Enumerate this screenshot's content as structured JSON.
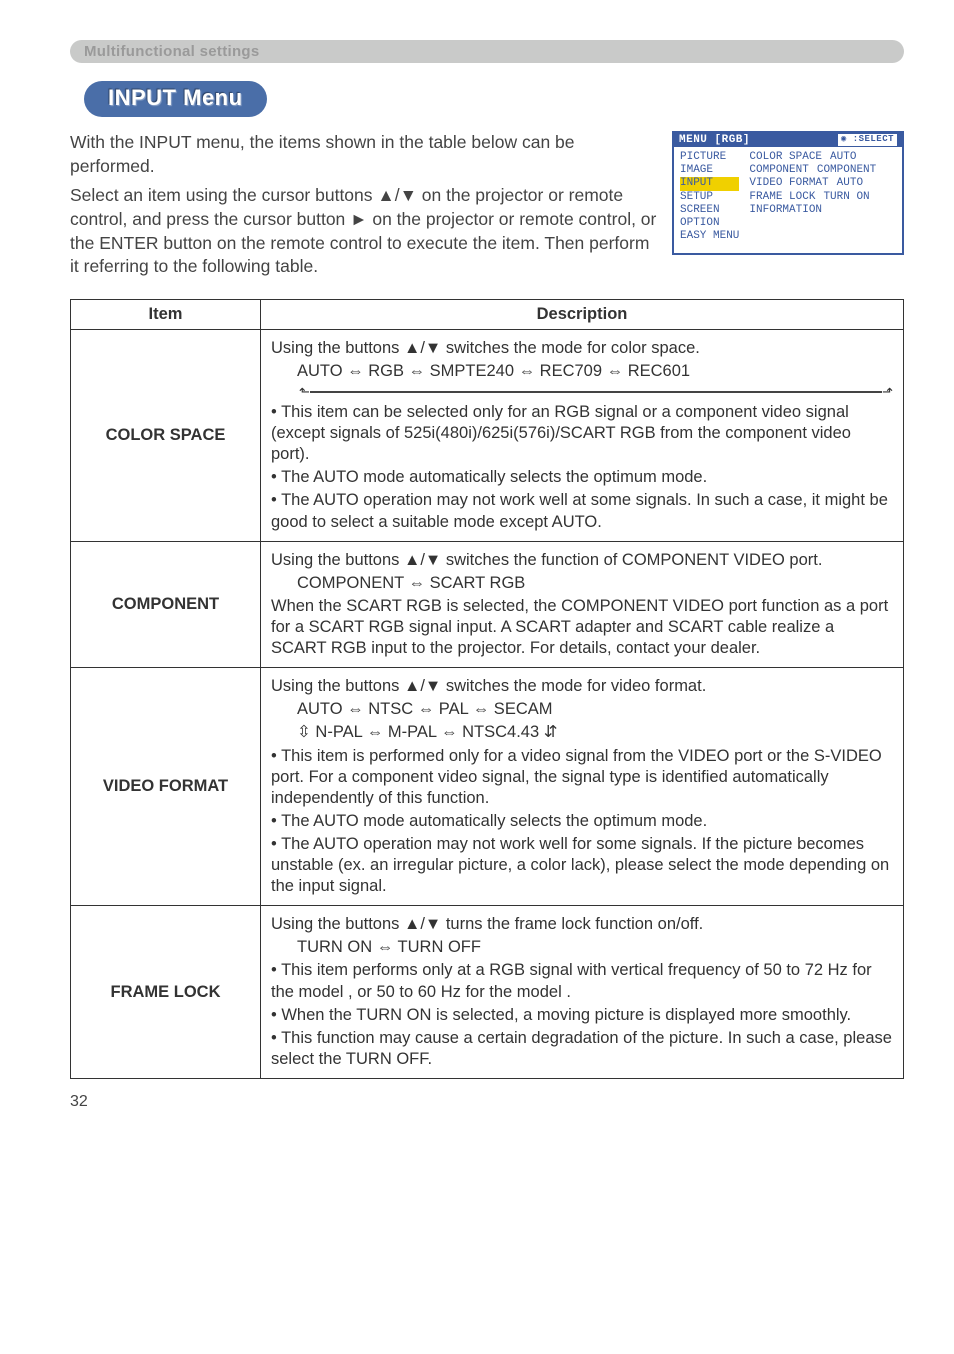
{
  "section_band": "Multifunctional settings",
  "pill": "INPUT Menu",
  "intro": {
    "p1": "With the INPUT menu, the items shown in the table below can be performed.",
    "p2_a": "Select an item using the cursor buttons ",
    "p2_arrows": "▲/▼",
    "p2_b": " on the projector or remote control, and press the cursor button ",
    "p2_right": "►",
    "p2_c": " on the projector or remote control, or the ENTER button on the remote control to execute the item. Then perform it referring to the following table."
  },
  "osd": {
    "title_left": "MENU [RGB]",
    "title_right": ":SELECT",
    "left_items": [
      "PICTURE",
      "IMAGE",
      "INPUT",
      "SETUP",
      "SCREEN",
      "OPTION",
      "EASY MENU"
    ],
    "right_rows": [
      {
        "k": "COLOR SPACE",
        "v": "AUTO"
      },
      {
        "k": "COMPONENT",
        "v": "COMPONENT"
      },
      {
        "k": "VIDEO FORMAT",
        "v": "AUTO"
      },
      {
        "k": "FRAME LOCK",
        "v": "TURN ON"
      },
      {
        "k": "INFORMATION",
        "v": ""
      }
    ]
  },
  "table": {
    "head_item": "Item",
    "head_desc": "Description",
    "rows": {
      "color_space": {
        "item": "COLOR SPACE",
        "l1a": "Using the buttons ",
        "l1arrows": "▲/▼",
        "l1b": " switches the mode for color space.",
        "l2": "AUTO ⇔ RGB ⇔ SMPTE240 ⇔ REC709 ⇔ REC601",
        "b1": "• This item can be selected only for an RGB signal or a component video signal (except signals of 525i(480i)/625i(576i)/SCART RGB from the component video port).",
        "b2": "• The AUTO mode automatically selects the optimum mode.",
        "b3": "• The AUTO operation may not work well at some signals. In such a case, it might be good to select a suitable mode except AUTO."
      },
      "component": {
        "item": "COMPONENT",
        "l1a": "Using the buttons ",
        "l1arrows": "▲/▼",
        "l1b": " switches the function of COMPONENT VIDEO port.",
        "l2": "COMPONENT ⇔ SCART RGB",
        "p1": "When the SCART RGB is selected, the COMPONENT VIDEO port function as a port for a SCART RGB signal input. A SCART adapter and SCART cable realize a SCART RGB input to the projector. For details, contact your dealer."
      },
      "video_format": {
        "item": "VIDEO FORMAT",
        "l1a": "Using the buttons ",
        "l1arrows": "▲/▼",
        "l1b": " switches the mode for video format.",
        "l2": "AUTO  ⇔  NTSC  ⇔  PAL  ⇔  SECAM",
        "l3": "⇳ N-PAL ⇔ M-PAL ⇔ NTSC4.43 ⇵",
        "b1": "• This item is performed only for a video signal from the VIDEO port or the S-VIDEO port. For a component video signal, the signal type is identified automatically independently of this function.",
        "b2": "• The AUTO mode automatically selects the optimum mode.",
        "b3": "• The AUTO operation may not work well for some signals. If the picture becomes unstable (ex. an irregular picture, a color lack), please select the mode depending on the input signal."
      },
      "frame_lock": {
        "item": "FRAME LOCK",
        "l1a": "Using the buttons ",
        "l1arrows": "▲/▼",
        "l1b": " turns the frame lock function on/off.",
        "l2": "TURN ON ⇔ TURN OFF",
        "b1": "• This item performs only at a RGB signal with vertical frequency of 50 to 72 Hz for the model        , or 50 to 60 Hz for the model        .",
        "b2": "• When the TURN ON is selected, a moving picture is displayed more smoothly.",
        "b3": "• This function may cause a certain degradation of the picture. In such a case, please select the TURN OFF."
      }
    }
  },
  "pagenum": "32"
}
